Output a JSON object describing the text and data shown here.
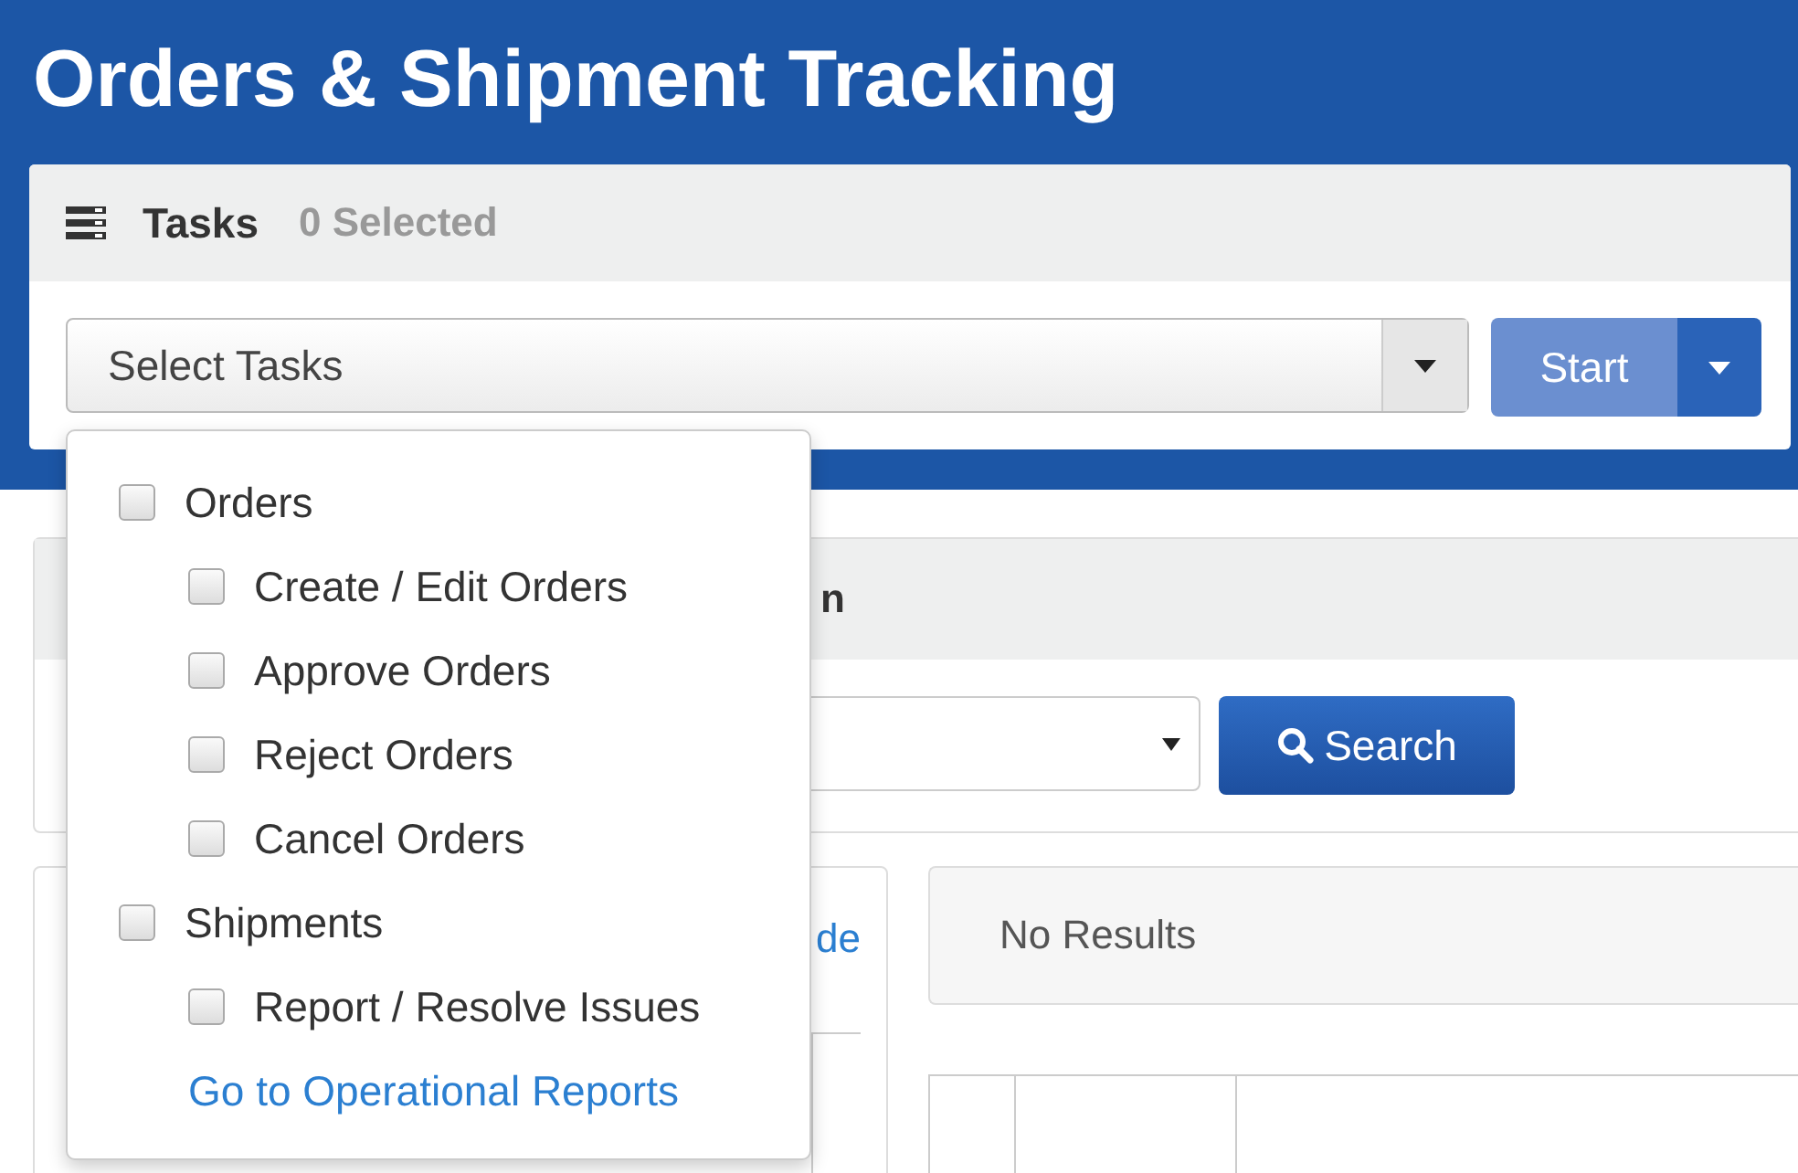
{
  "header": {
    "title": "Orders & Shipment Tracking"
  },
  "tasks_panel": {
    "title": "Tasks",
    "selected_count": "0 Selected",
    "select": {
      "placeholder": "Select Tasks"
    },
    "start_button": "Start"
  },
  "task_menu": {
    "items": [
      {
        "label": "Orders",
        "checked": false,
        "children": [
          {
            "label": "Create / Edit Orders",
            "checked": false
          },
          {
            "label": "Approve Orders",
            "checked": false
          },
          {
            "label": "Reject Orders",
            "checked": false
          },
          {
            "label": "Cancel Orders",
            "checked": false
          }
        ]
      },
      {
        "label": "Shipments",
        "checked": false,
        "children": [
          {
            "label": "Report / Resolve Issues",
            "checked": false
          }
        ]
      }
    ],
    "link": "Go to Operational Reports"
  },
  "search_panel": {
    "heading_fragment": "n",
    "search_button": "Search"
  },
  "filter_panel": {
    "link_fragment": "de"
  },
  "results_panel": {
    "message": "No Results"
  }
}
